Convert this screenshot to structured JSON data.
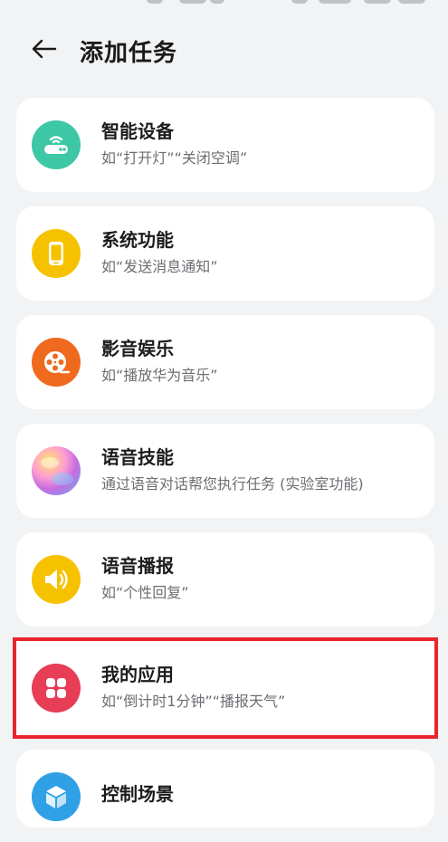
{
  "header": {
    "title": "添加任务"
  },
  "items": [
    {
      "name": "智能设备",
      "desc": "如“打开灯”“关闭空调”",
      "icon": "router-icon",
      "color": "#3ec7a5"
    },
    {
      "name": "系统功能",
      "desc": "如“发送消息通知”",
      "icon": "phone-icon",
      "color": "#f6c200"
    },
    {
      "name": "影音娱乐",
      "desc": "如“播放华为音乐”",
      "icon": "film-reel-icon",
      "color": "#ef6a1e"
    },
    {
      "name": "语音技能",
      "desc": "通过语音对话帮您执行任务 (实验室功能)",
      "icon": "voice-assistant-icon",
      "color": "#c86bd8"
    },
    {
      "name": "语音播报",
      "desc": "如“个性回复”",
      "icon": "speaker-icon",
      "color": "#f6c200"
    },
    {
      "name": "我的应用",
      "desc": "如“倒计时1分钟”“播报天气”",
      "icon": "apps-grid-icon",
      "color": "#e73d57"
    },
    {
      "name": "控制场景",
      "desc": "",
      "icon": "cube-icon",
      "color": "#2fa0e6"
    }
  ],
  "colors": {
    "background": "#f1f3f5",
    "card": "#ffffff",
    "highlight": "#e8262c"
  }
}
